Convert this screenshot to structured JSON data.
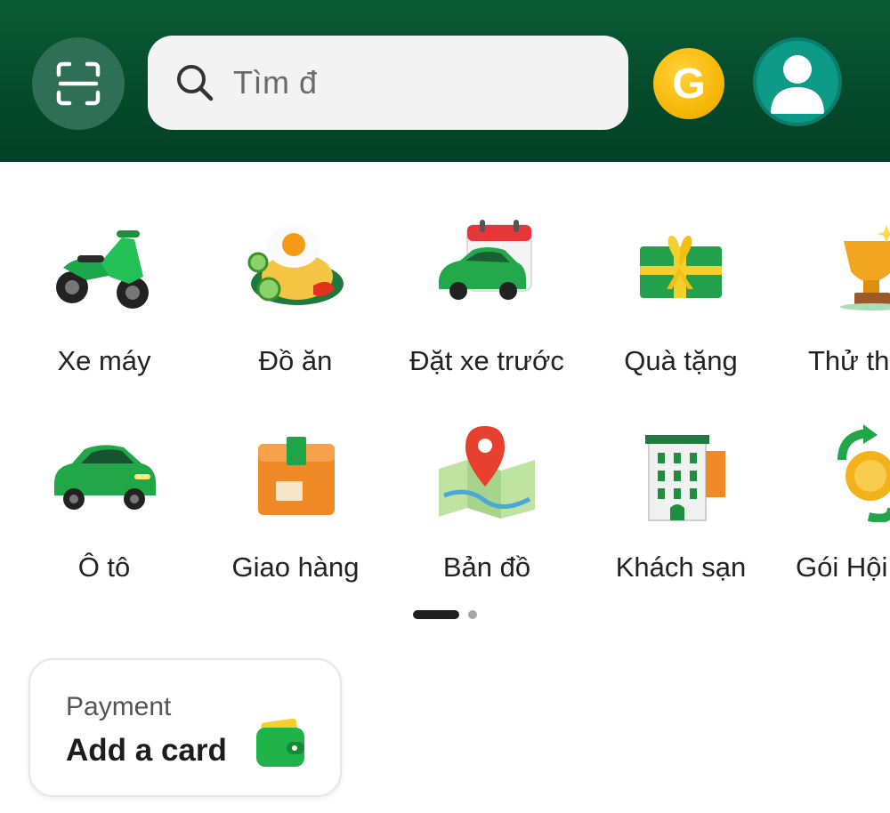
{
  "header": {
    "search_placeholder": "Tìm đ",
    "coin_letter": "G",
    "brand_color": "#044a2b",
    "scan_icon": "scan-icon",
    "profile_icon": "user-icon"
  },
  "services": [
    {
      "label": "Xe máy",
      "icon": "motorbike-icon"
    },
    {
      "label": "Đồ ăn",
      "icon": "food-icon"
    },
    {
      "label": "Đặt xe trước",
      "icon": "scheduled-car-icon"
    },
    {
      "label": "Quà tặng",
      "icon": "gift-icon"
    },
    {
      "label": "Thử th",
      "icon": "trophy-icon"
    },
    {
      "label": "Ô tô",
      "icon": "car-icon"
    },
    {
      "label": "Giao hàng",
      "icon": "package-icon"
    },
    {
      "label": "Bản đồ",
      "icon": "map-icon"
    },
    {
      "label": "Khách sạn",
      "icon": "hotel-icon"
    },
    {
      "label": "Gói Hội",
      "icon": "membership-coin-icon"
    }
  ],
  "pager": {
    "current": 1,
    "total": 2
  },
  "payment": {
    "title": "Payment",
    "action": "Add a card",
    "icon": "wallet-icon",
    "wallet_color": "#1fb34a"
  }
}
